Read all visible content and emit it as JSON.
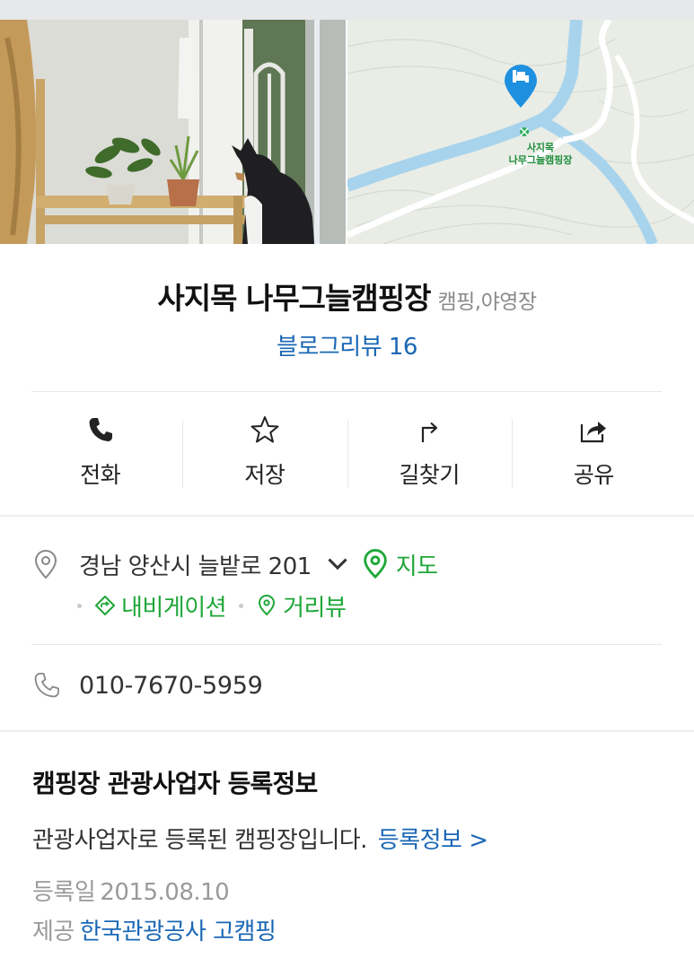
{
  "place": {
    "name": "사지목 나무그늘캠핑장",
    "category": "캠핑,야영장",
    "blog_review": "블로그리뷰 16"
  },
  "map_thumbnail": {
    "label_line1": "사지목",
    "label_line2": "나무그늘캠핑장",
    "marker_icon": "bed-icon"
  },
  "actions": [
    {
      "label": "전화",
      "icon": "phone-icon"
    },
    {
      "label": "저장",
      "icon": "star-icon"
    },
    {
      "label": "길찾기",
      "icon": "directions-icon"
    },
    {
      "label": "공유",
      "icon": "share-icon"
    }
  ],
  "address": {
    "text": "경남 양산시 늘밭로 201",
    "map_link": "지도",
    "navigation_link": "내비게이션",
    "streetview_link": "거리뷰"
  },
  "phone": {
    "number": "010-7670-5959"
  },
  "registration": {
    "title": "캠핑장 관광사업자 등록정보",
    "description": "관광사업자로 등록된 캠핑장입니다.",
    "link": "등록정보 >",
    "date_label": "등록일",
    "date_value": "2015.08.10",
    "provider_label": "제공",
    "provider_value": "한국관광공사 고캠핑"
  },
  "colors": {
    "link_blue": "#1a67b5",
    "link_green": "#1fa738",
    "text_gray": "#8a8a8a"
  }
}
